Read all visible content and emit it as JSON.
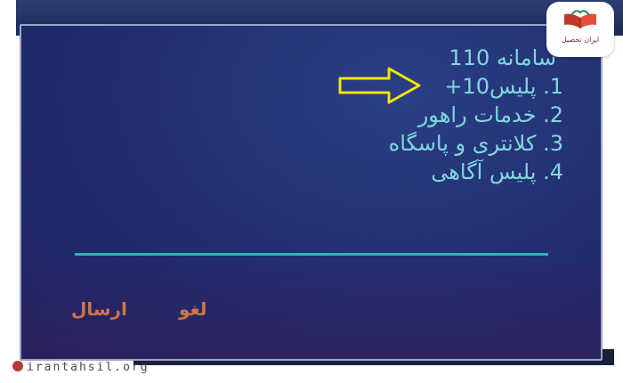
{
  "menu": {
    "title": "سامانه 110",
    "items": [
      {
        "number": "1.",
        "label": "پلیس10+"
      },
      {
        "number": "2.",
        "label": "خدمات راهور"
      },
      {
        "number": "3.",
        "label": "کلانتری و پاسگاه"
      },
      {
        "number": "4.",
        "label": "پلیس آگاهی"
      }
    ]
  },
  "softkeys": {
    "send_label": "ارسال",
    "cancel_label": "لغو"
  },
  "branding": {
    "logo_text": "ایران تحصیل",
    "watermark": "irantahsil.org"
  },
  "colors": {
    "screen_bg": "#232f72",
    "menu_text": "#7fd8dd",
    "softkey_text": "#f08a44",
    "divider": "#2fb3b6",
    "arrow": "#f2e600"
  },
  "icons": [
    "arrow-right-icon",
    "book-logo-icon",
    "globe-icon"
  ]
}
